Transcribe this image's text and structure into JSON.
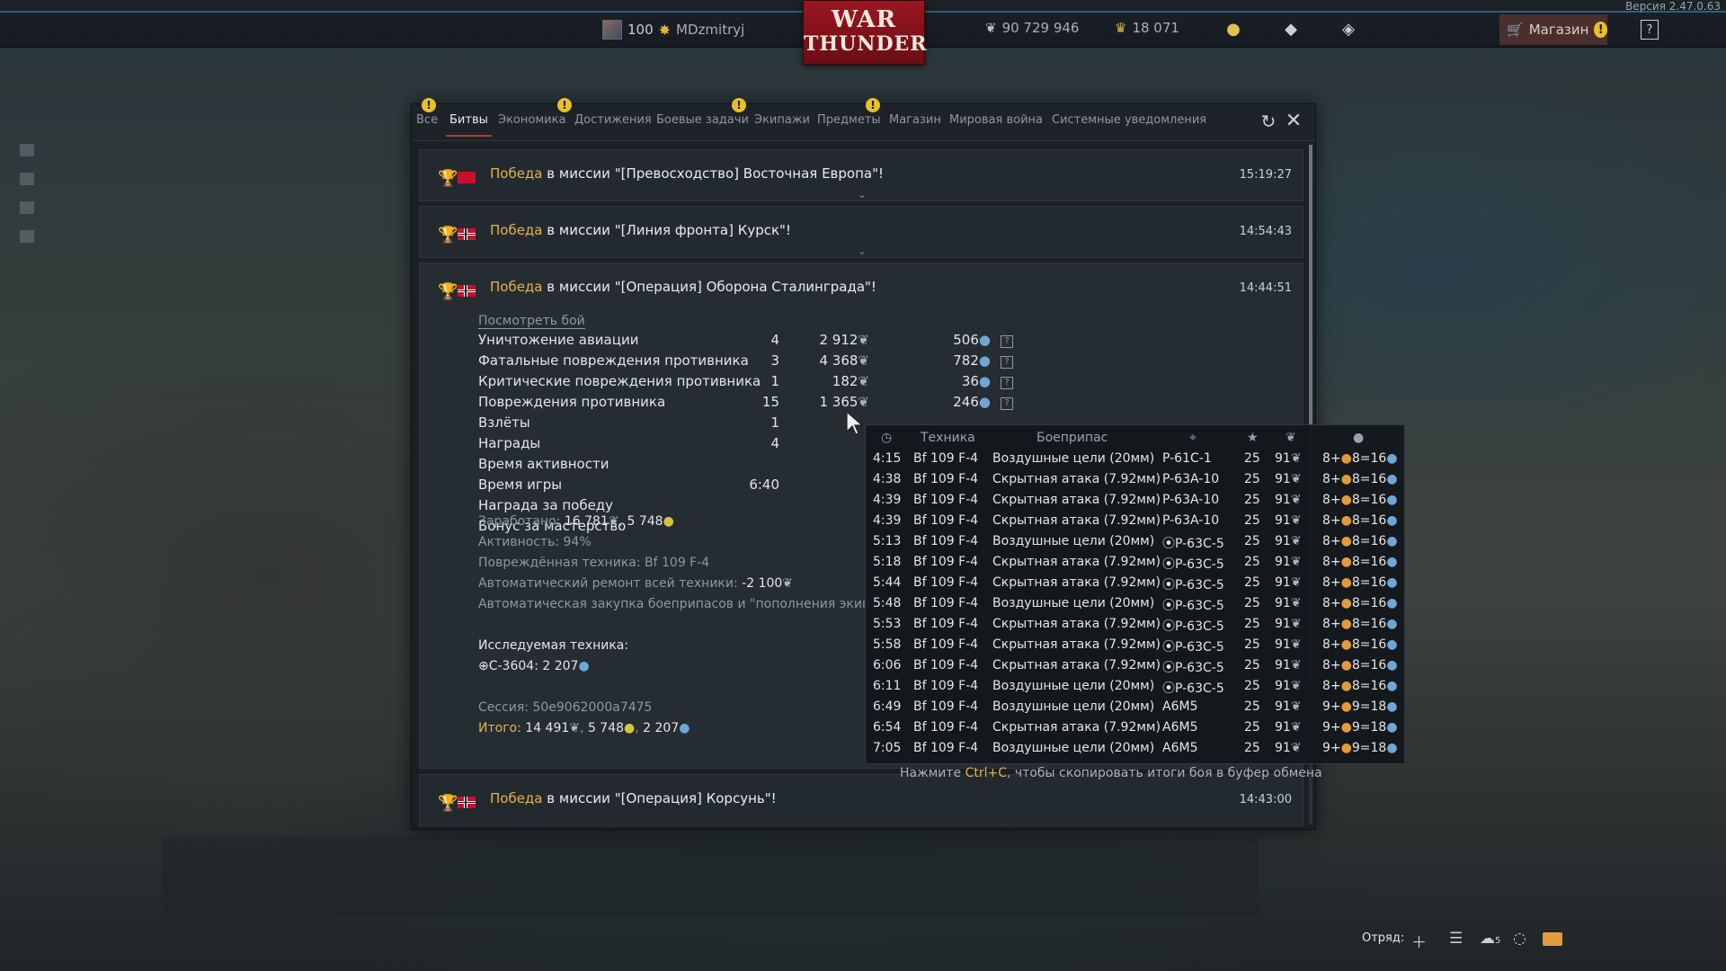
{
  "version": "Версия 2.47.0.63",
  "profile": {
    "level": "100",
    "nickname": "MDzmitryj"
  },
  "logo": {
    "line1": "WAR",
    "line2": "THUNDER"
  },
  "currency": {
    "silver": "90 729 946",
    "gold": "18 071"
  },
  "shop": {
    "label": "Магазин"
  },
  "tabs": [
    {
      "label": "Все",
      "alert": true
    },
    {
      "label": "Битвы",
      "active": true
    },
    {
      "label": "Экономика",
      "alert": true
    },
    {
      "label": "Достижения"
    },
    {
      "label": "Боевые задачи",
      "alert": true
    },
    {
      "label": "Экипажи"
    },
    {
      "label": "Предметы",
      "alert": true
    },
    {
      "label": "Магазин"
    },
    {
      "label": "Мировая война"
    },
    {
      "label": "Системные уведомления"
    }
  ],
  "messages": [
    {
      "win": "Победа",
      "text": " в миссии \"[Превосходство] Восточная Европа\"!",
      "time": "15:19:27",
      "flag": "ussr"
    },
    {
      "win": "Победа",
      "text": " в миссии \"[Линия фронта] Курск\"!",
      "time": "14:54:43",
      "flag": "ger"
    },
    {
      "win": "Победа",
      "text": " в миссии \"[Операция] Оборона Сталинграда\"!",
      "time": "14:44:51",
      "flag": "ger"
    },
    {
      "win": "Победа",
      "text": " в миссии \"[Операция] Корсунь\"!",
      "time": "14:43:00",
      "flag": "ger"
    }
  ],
  "expanded": {
    "watch": "Посмотреть бой",
    "stats": [
      {
        "label": "Уничтожение авиации",
        "count": "4",
        "silver": "2 912",
        "rp": "506",
        "help": true
      },
      {
        "label": "Фатальные повреждения противника",
        "count": "3",
        "silver": "4 368",
        "rp": "782",
        "help": true
      },
      {
        "label": "Критические повреждения противника",
        "count": "1",
        "silver": "182",
        "rp": "36",
        "help": true
      },
      {
        "label": "Повреждения противника",
        "count": "15",
        "silver": "1 365",
        "rp": "246",
        "help": true
      },
      {
        "label": "Взлёты",
        "count": "1"
      },
      {
        "label": "Награды",
        "count": "4"
      },
      {
        "label": "Время активности",
        "count": ""
      },
      {
        "label": "Время игры",
        "count": "6:40"
      },
      {
        "label": "Награда за победу",
        "count": ""
      },
      {
        "label": "Бонус за мастерство",
        "count": ""
      }
    ],
    "earned_label": "Заработано: ",
    "earned_silver": "16 781",
    "earned_gold": "5 748",
    "activity": "Активность: 94%",
    "damaged": "Повреждённая техника: Bf 109 F-4",
    "repair_label": "Автоматический ремонт всей техники: ",
    "repair_value": "-2 100",
    "autobuy": "Автоматическая закупка боеприпасов и \"пополнения экип",
    "research_label": "Исследуемая техника:",
    "research_value": "С-3604: 2 207",
    "session": "Сессия: 50e9062000a7475",
    "total_label": "Итого:",
    "total_silver": "14 491",
    "total_gold": "5 748",
    "total_rp": "2 207"
  },
  "tooltip": {
    "headers": {
      "time_icon": "clock-icon",
      "vehicle": "Техника",
      "ammo": "Боеприпас",
      "target_icon": "crosshair-icon",
      "star_icon": "star-icon",
      "silver_icon": "silver-lion-icon",
      "rp_icon": "research-points-icon"
    },
    "rows": [
      {
        "time": "4:15",
        "vehicle": "Bf 109 F-4",
        "ammo": "Воздушные цели (20мм)",
        "target": "P-61C-1",
        "stars": "25",
        "silver": "91",
        "rp": "8+",
        "rp2": "8=16",
        "marked": false
      },
      {
        "time": "4:38",
        "vehicle": "Bf 109 F-4",
        "ammo": "Скрытная атака (7.92мм)",
        "target": "P-63A-10",
        "stars": "25",
        "silver": "91",
        "rp": "8+",
        "rp2": "8=16",
        "marked": false
      },
      {
        "time": "4:39",
        "vehicle": "Bf 109 F-4",
        "ammo": "Скрытная атака (7.92мм)",
        "target": "P-63A-10",
        "stars": "25",
        "silver": "91",
        "rp": "8+",
        "rp2": "8=16",
        "marked": false
      },
      {
        "time": "4:39",
        "vehicle": "Bf 109 F-4",
        "ammo": "Скрытная атака (7.92мм)",
        "target": "P-63A-10",
        "stars": "25",
        "silver": "91",
        "rp": "8+",
        "rp2": "8=16",
        "marked": false
      },
      {
        "time": "5:13",
        "vehicle": "Bf 109 F-4",
        "ammo": "Воздушные цели (20мм)",
        "target": "P-63C-5",
        "stars": "25",
        "silver": "91",
        "rp": "8+",
        "rp2": "8=16",
        "marked": true
      },
      {
        "time": "5:18",
        "vehicle": "Bf 109 F-4",
        "ammo": "Скрытная атака (7.92мм)",
        "target": "P-63C-5",
        "stars": "25",
        "silver": "91",
        "rp": "8+",
        "rp2": "8=16",
        "marked": true
      },
      {
        "time": "5:44",
        "vehicle": "Bf 109 F-4",
        "ammo": "Скрытная атака (7.92мм)",
        "target": "P-63C-5",
        "stars": "25",
        "silver": "91",
        "rp": "8+",
        "rp2": "8=16",
        "marked": true
      },
      {
        "time": "5:48",
        "vehicle": "Bf 109 F-4",
        "ammo": "Воздушные цели (20мм)",
        "target": "P-63C-5",
        "stars": "25",
        "silver": "91",
        "rp": "8+",
        "rp2": "8=16",
        "marked": true
      },
      {
        "time": "5:53",
        "vehicle": "Bf 109 F-4",
        "ammo": "Скрытная атака (7.92мм)",
        "target": "P-63C-5",
        "stars": "25",
        "silver": "91",
        "rp": "8+",
        "rp2": "8=16",
        "marked": true
      },
      {
        "time": "5:58",
        "vehicle": "Bf 109 F-4",
        "ammo": "Скрытная атака (7.92мм)",
        "target": "P-63C-5",
        "stars": "25",
        "silver": "91",
        "rp": "8+",
        "rp2": "8=16",
        "marked": true
      },
      {
        "time": "6:06",
        "vehicle": "Bf 109 F-4",
        "ammo": "Скрытная атака (7.92мм)",
        "target": "P-63C-5",
        "stars": "25",
        "silver": "91",
        "rp": "8+",
        "rp2": "8=16",
        "marked": true
      },
      {
        "time": "6:11",
        "vehicle": "Bf 109 F-4",
        "ammo": "Воздушные цели (20мм)",
        "target": "P-63C-5",
        "stars": "25",
        "silver": "91",
        "rp": "8+",
        "rp2": "8=16",
        "marked": true
      },
      {
        "time": "6:49",
        "vehicle": "Bf 109 F-4",
        "ammo": "Воздушные цели (20мм)",
        "target": "A6M5",
        "stars": "25",
        "silver": "91",
        "rp": "9+",
        "rp2": "9=18",
        "marked": false
      },
      {
        "time": "6:54",
        "vehicle": "Bf 109 F-4",
        "ammo": "Скрытная атака (7.92мм)",
        "target": "A6M5",
        "stars": "25",
        "silver": "91",
        "rp": "9+",
        "rp2": "9=18",
        "marked": false
      },
      {
        "time": "7:05",
        "vehicle": "Bf 109 F-4",
        "ammo": "Воздушные цели (20мм)",
        "target": "A6M5",
        "stars": "25",
        "silver": "91",
        "rp": "9+",
        "rp2": "9=18",
        "marked": false
      }
    ]
  },
  "copy_hint": {
    "pre": "Нажмите ",
    "key": "Ctrl+C",
    "post": ", чтобы скопировать итоги боя в буфер обмена"
  },
  "bottom": {
    "squad_label": "Отряд:",
    "friends_count": "5"
  }
}
